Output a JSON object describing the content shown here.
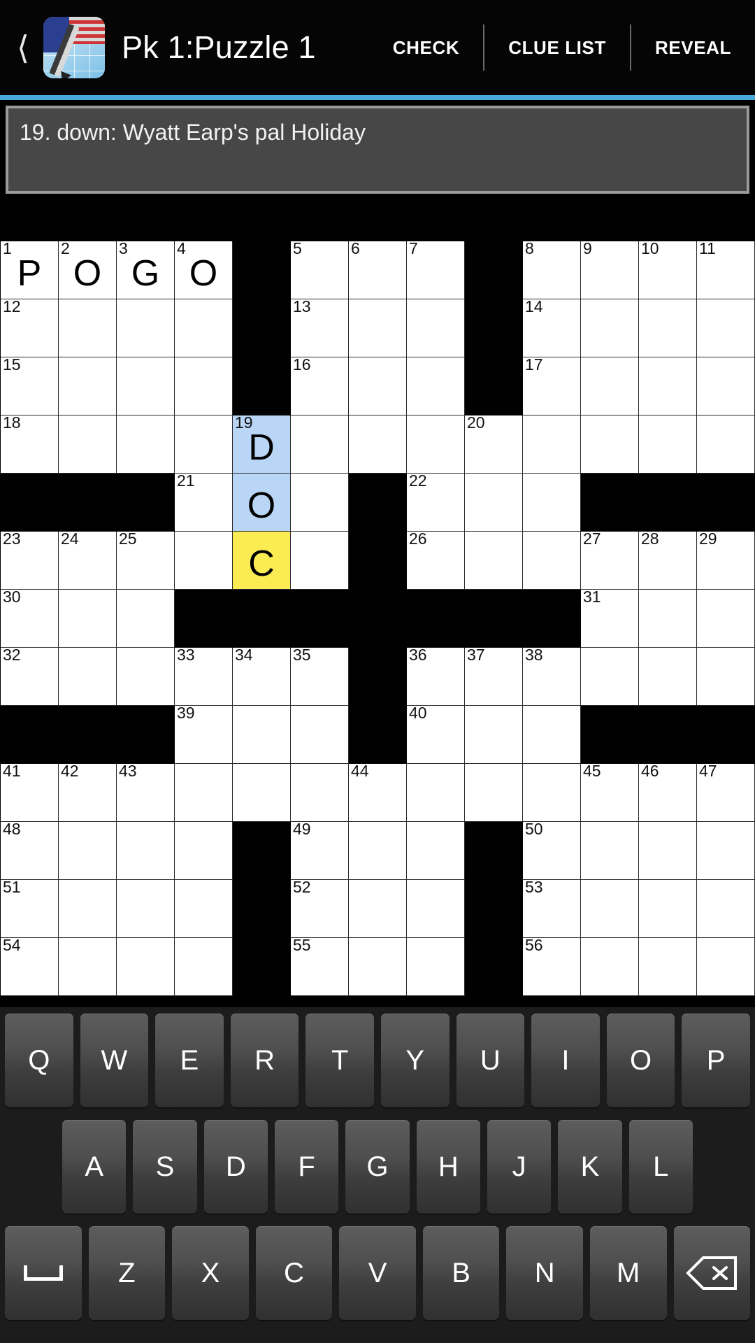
{
  "header": {
    "back_icon": "chevron-left-icon",
    "app_icon": "crossword-app-icon",
    "title": "Pk 1:Puzzle 1",
    "actions": [
      {
        "label": "CHECK",
        "name": "check-button"
      },
      {
        "label": "CLUE LIST",
        "name": "clue-list-button"
      },
      {
        "label": "REVEAL",
        "name": "reveal-button"
      }
    ],
    "accent_color": "#4aa8db"
  },
  "clue": {
    "text": "19. down: Wyatt Earp's pal Holiday",
    "number": "19",
    "direction": "down",
    "clue_body": "Wyatt Earp's pal Holiday"
  },
  "grid": {
    "columns": 13,
    "rows": 13,
    "colors": {
      "block": "#000000",
      "empty": "#ffffff",
      "highlight_word": "#bad6f7",
      "highlight_current": "#fcec54"
    },
    "cells": [
      [
        {
          "n": "1",
          "l": "P"
        },
        {
          "n": "2",
          "l": "O"
        },
        {
          "n": "3",
          "l": "G"
        },
        {
          "n": "4",
          "l": "O"
        },
        {
          "b": true
        },
        {
          "n": "5"
        },
        {
          "n": "6"
        },
        {
          "n": "7"
        },
        {
          "b": true
        },
        {
          "n": "8"
        },
        {
          "n": "9"
        },
        {
          "n": "10"
        },
        {
          "n": "11"
        }
      ],
      [
        {
          "n": "12"
        },
        {},
        {},
        {},
        {
          "b": true
        },
        {
          "n": "13"
        },
        {},
        {},
        {
          "b": true
        },
        {
          "n": "14"
        },
        {},
        {},
        {}
      ],
      [
        {
          "n": "15"
        },
        {},
        {},
        {},
        {
          "b": true
        },
        {
          "n": "16"
        },
        {},
        {},
        {
          "b": true
        },
        {
          "n": "17"
        },
        {},
        {},
        {}
      ],
      [
        {
          "n": "18"
        },
        {},
        {},
        {},
        {
          "n": "19",
          "l": "D",
          "h": "word"
        },
        {},
        {},
        {},
        {
          "n": "20"
        },
        {},
        {},
        {},
        {}
      ],
      [
        {
          "b": true
        },
        {
          "b": true
        },
        {
          "b": true
        },
        {
          "n": "21"
        },
        {
          "l": "O",
          "h": "word"
        },
        {},
        {
          "b": true
        },
        {
          "n": "22"
        },
        {},
        {},
        {
          "b": true
        },
        {
          "b": true
        },
        {
          "b": true
        }
      ],
      [
        {
          "n": "23"
        },
        {
          "n": "24"
        },
        {
          "n": "25"
        },
        {},
        {
          "l": "C",
          "h": "current"
        },
        {},
        {
          "b": true
        },
        {
          "n": "26"
        },
        {},
        {},
        {
          "n": "27"
        },
        {
          "n": "28"
        },
        {
          "n": "29"
        }
      ],
      [
        {
          "n": "30"
        },
        {},
        {},
        {
          "b": true
        },
        {
          "b": true
        },
        {
          "b": true
        },
        {
          "b": true
        },
        {
          "b": true
        },
        {
          "b": true
        },
        {
          "b": true
        },
        {
          "n": "31"
        },
        {},
        {}
      ],
      [
        {
          "n": "32"
        },
        {},
        {},
        {
          "n": "33"
        },
        {
          "n": "34"
        },
        {
          "n": "35"
        },
        {
          "b": true
        },
        {
          "n": "36"
        },
        {
          "n": "37"
        },
        {
          "n": "38"
        },
        {},
        {},
        {}
      ],
      [
        {
          "b": true
        },
        {
          "b": true
        },
        {
          "b": true
        },
        {
          "n": "39"
        },
        {},
        {},
        {
          "b": true
        },
        {
          "n": "40"
        },
        {},
        {},
        {
          "b": true
        },
        {
          "b": true
        },
        {
          "b": true
        }
      ],
      [
        {
          "n": "41"
        },
        {
          "n": "42"
        },
        {
          "n": "43"
        },
        {},
        {},
        {},
        {
          "n": "44"
        },
        {},
        {},
        {},
        {
          "n": "45"
        },
        {
          "n": "46"
        },
        {
          "n": "47"
        }
      ],
      [
        {
          "n": "48"
        },
        {},
        {},
        {},
        {
          "b": true
        },
        {
          "n": "49"
        },
        {},
        {},
        {
          "b": true
        },
        {
          "n": "50"
        },
        {},
        {},
        {}
      ],
      [
        {
          "n": "51"
        },
        {},
        {},
        {},
        {
          "b": true
        },
        {
          "n": "52"
        },
        {},
        {},
        {
          "b": true
        },
        {
          "n": "53"
        },
        {},
        {},
        {}
      ],
      [
        {
          "n": "54"
        },
        {},
        {},
        {},
        {
          "b": true
        },
        {
          "n": "55"
        },
        {},
        {},
        {
          "b": true
        },
        {
          "n": "56"
        },
        {},
        {},
        {}
      ]
    ]
  },
  "keyboard": {
    "rows": [
      [
        "Q",
        "W",
        "E",
        "R",
        "T",
        "Y",
        "U",
        "I",
        "O",
        "P"
      ],
      [
        "A",
        "S",
        "D",
        "F",
        "G",
        "H",
        "J",
        "K",
        "L"
      ],
      [
        "SPACE",
        "Z",
        "X",
        "C",
        "V",
        "B",
        "N",
        "M",
        "BACKSPACE"
      ]
    ],
    "space_label": "space-key",
    "backspace_label": "backspace-key"
  }
}
